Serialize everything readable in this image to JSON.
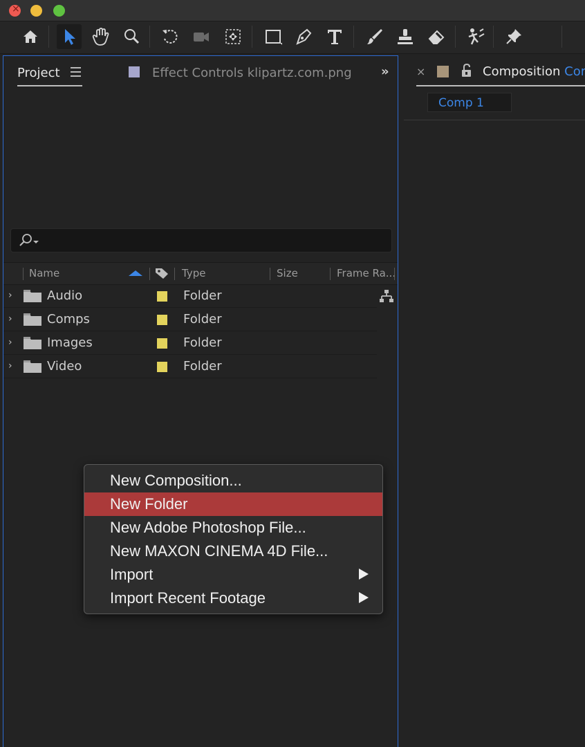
{
  "toolbar": {
    "tools": [
      "home-icon",
      "selection-tool-icon",
      "hand-tool-icon",
      "zoom-tool-icon",
      "rotate-tool-icon",
      "camera-tool-icon",
      "pan-behind-tool-icon",
      "rectangle-tool-icon",
      "pen-tool-icon",
      "type-tool-icon",
      "brush-tool-icon",
      "clone-stamp-tool-icon",
      "eraser-tool-icon",
      "puppet-tool-icon",
      "pin-tool-icon"
    ]
  },
  "project_panel": {
    "tab_label": "Project",
    "effect_tab_label": "Effect Controls klipartz.com.png",
    "search_placeholder": "",
    "columns": {
      "name": "Name",
      "type": "Type",
      "size": "Size",
      "frame_rate": "Frame Ra..."
    },
    "rows": [
      {
        "name": "Audio",
        "type": "Folder"
      },
      {
        "name": "Comps",
        "type": "Folder"
      },
      {
        "name": "Images",
        "type": "Folder"
      },
      {
        "name": "Video",
        "type": "Folder"
      }
    ],
    "label_color": "#e3d35c"
  },
  "composition_panel": {
    "title": "Composition",
    "title_accent": "Cor",
    "subtab": "Comp 1"
  },
  "context_menu": {
    "items": [
      {
        "label": "New Composition...",
        "submenu": false
      },
      {
        "label": "New Folder",
        "submenu": false,
        "highlighted": true
      },
      {
        "label": "New Adobe Photoshop File...",
        "submenu": false
      },
      {
        "label": "New MAXON CINEMA 4D File...",
        "submenu": false
      },
      {
        "label": "Import",
        "submenu": true
      },
      {
        "label": "Import Recent Footage",
        "submenu": true
      }
    ],
    "highlight_color": "#ab3a3a"
  },
  "colors": {
    "accent": "#3c86e6",
    "panel_focus_border": "#2e6bd3"
  }
}
